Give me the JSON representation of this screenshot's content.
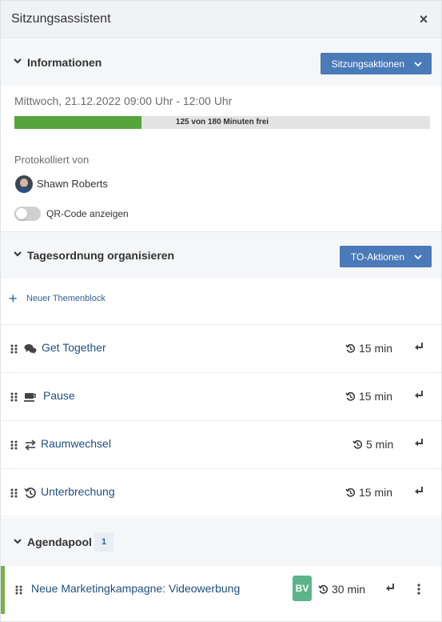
{
  "header": {
    "title": "Sitzungsassistent",
    "close_label": "×"
  },
  "info_section": {
    "title": "Informationen",
    "action_button": "Sitzungsaktionen",
    "date_time": "Mittwoch, 21.12.2022  09:00 Uhr - 12:00 Uhr",
    "progress": {
      "text": "125 von 180 Minuten frei",
      "fill_fraction": 0.306
    },
    "protocolled_by_label": "Protokolliert von",
    "person_name": "Shawn Roberts",
    "qr_toggle": {
      "label": "QR-Code anzeigen",
      "enabled": false
    }
  },
  "agenda_section": {
    "title": "Tagesordnung organisieren",
    "action_button": "TO-Aktionen",
    "new_block_label": "Neuer Themenblock",
    "items": [
      {
        "icon": "chat-bubbles-icon",
        "title": "Get Together",
        "duration": "15 min"
      },
      {
        "icon": "coffee-cup-icon",
        "title": "Pause",
        "duration": "15 min"
      },
      {
        "icon": "swap-arrows-icon",
        "title": "Raumwechsel",
        "duration": "5 min"
      },
      {
        "icon": "history-icon",
        "title": "Unterbrechung",
        "duration": "15 min"
      }
    ]
  },
  "pool_section": {
    "title": "Agendapool",
    "count": "1",
    "items": [
      {
        "title": "Neue Marketingkampagne: Videowerbung",
        "badge": "BV",
        "duration": "30 min"
      }
    ]
  },
  "colors": {
    "accent_button": "#4a7ab8",
    "progress_fill": "#57a33c",
    "link": "#1e4f7f",
    "pool_bar": "#7bae4a",
    "badge_bv": "#5cb58a"
  }
}
